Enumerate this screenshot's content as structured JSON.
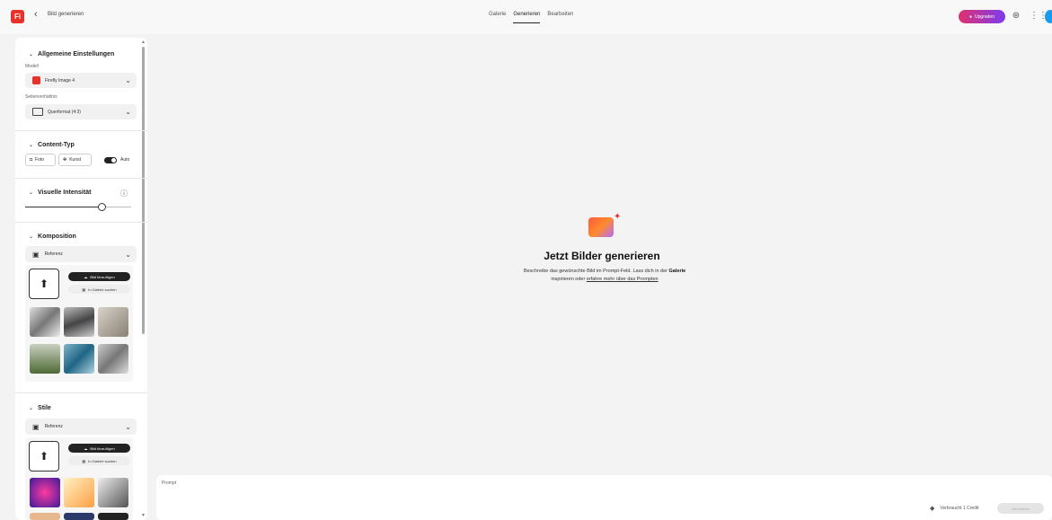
{
  "topbar": {
    "logo_text": "Fi",
    "back_icon": "chevron-left-icon",
    "title": "Bild generieren",
    "tabs": [
      {
        "label": "Galerie",
        "active": false
      },
      {
        "label": "Generieren",
        "active": true
      },
      {
        "label": "Bearbeiten",
        "active": false
      }
    ],
    "upgrade_label": "Upgraden",
    "help_icon": "help-icon",
    "apps_icon": "apps-grid-icon"
  },
  "panel": {
    "general": {
      "title": "Allgemeine Einstellungen",
      "model_label": "Modell",
      "model_value": "Firefly Image 4",
      "aspect_label": "Seitenverhältnis",
      "aspect_value": "Querformat (4:3)"
    },
    "content_type": {
      "title": "Content-Typ",
      "photo": "Foto",
      "art": "Kunst",
      "auto": "Auto"
    },
    "visual_intensity": {
      "title": "Visuelle Intensität",
      "level": 0.72
    },
    "composition": {
      "title": "Komposition",
      "select_value": "Referenz",
      "add_image": "Bild hinzufügen",
      "search_gallery": "In Galerie suchen"
    },
    "styles": {
      "title": "Stile",
      "select_value": "Referenz",
      "add_image": "Bild hinzufügen",
      "search_gallery": "In Galerie suchen"
    }
  },
  "main": {
    "title": "Jetzt Bilder generieren",
    "text_1": "Beschreibe das gewünschte Bild im Prompt-Feld. Lass dich in der ",
    "text_bold": "Galerie",
    "text_2": " inspirieren oder ",
    "text_link": "erfahre mehr über das Prompten"
  },
  "prompt": {
    "label": "Prompt",
    "credit_text": "Verbraucht 1 Credit",
    "generate_label": "Generieren"
  },
  "colors": {
    "brand_red": "#e8312b",
    "upgrade_start": "#e0306d",
    "upgrade_end": "#7b3cf0"
  }
}
